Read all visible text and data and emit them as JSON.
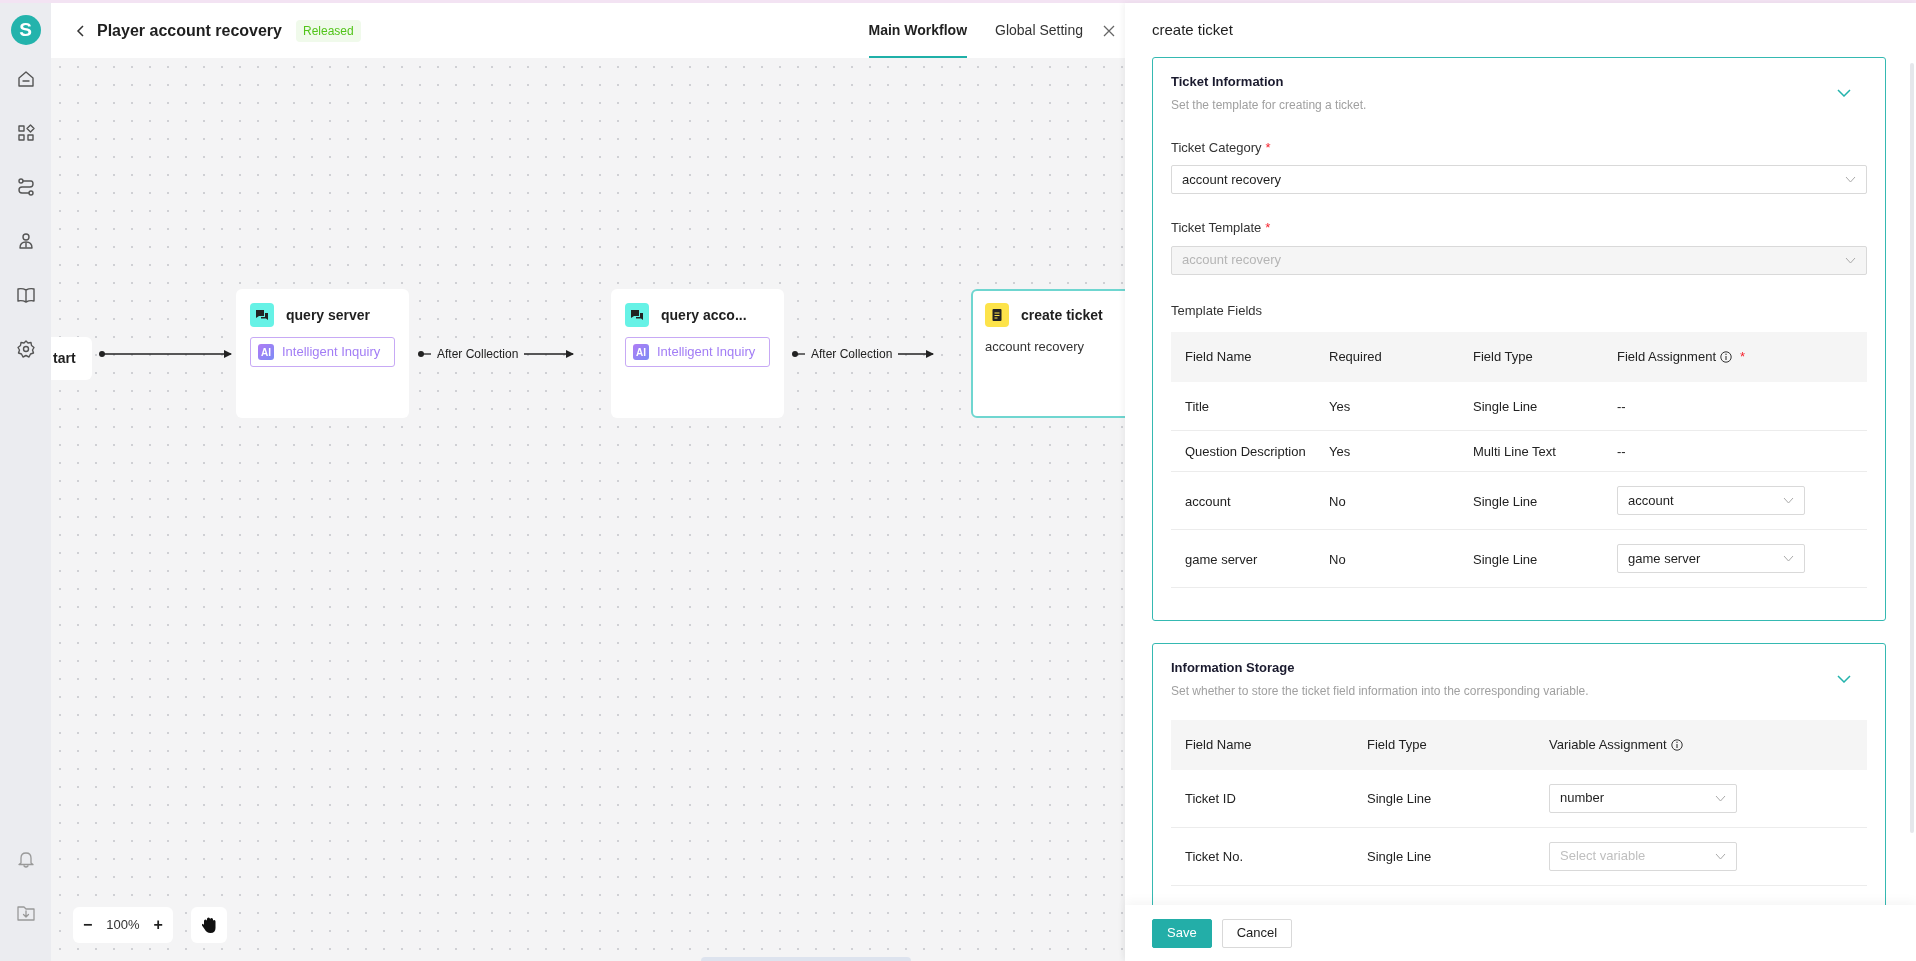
{
  "sidebar": {
    "logo": "S"
  },
  "header": {
    "title": "Player account recovery",
    "status_badge": "Released",
    "tabs": [
      {
        "label": "Main Workflow",
        "selected": true
      },
      {
        "label": "Global Setting",
        "selected": false
      }
    ]
  },
  "canvas": {
    "nodes": [
      {
        "kind": "start",
        "title": "tart",
        "selected": false
      },
      {
        "kind": "inquiry",
        "title": "query server",
        "tag": "Intelligent Inquiry",
        "tag_badge": "AI",
        "selected": false
      },
      {
        "kind": "inquiry",
        "title": "query acco...",
        "tag": "Intelligent Inquiry",
        "tag_badge": "AI",
        "selected": false
      },
      {
        "kind": "ticket",
        "title": "create ticket",
        "body": "account recovery",
        "selected": true
      }
    ],
    "edges": [
      {
        "kind": "plain"
      },
      {
        "kind": "labeled",
        "label": "After Collection"
      },
      {
        "kind": "labeled",
        "label": "After Collection"
      }
    ],
    "zoom": {
      "value": "100%",
      "minus": "−",
      "plus": "+"
    }
  },
  "panel": {
    "title": "create ticket",
    "sections": [
      {
        "title": "Ticket Information",
        "subtitle": "Set the template for creating a ticket.",
        "expanded": true,
        "fields": [
          {
            "label": "Ticket Category",
            "required_mark": "*",
            "value": "account recovery",
            "disabled": false
          },
          {
            "label": "Ticket Template",
            "required_mark": "*",
            "value": "account recovery",
            "disabled": true
          }
        ],
        "table_title": "Template Fields",
        "columns": [
          {
            "label": "Field Name",
            "info": false
          },
          {
            "label": "Required",
            "info": false
          },
          {
            "label": "Field Type",
            "info": false
          },
          {
            "label": "Field Assignment",
            "info": true,
            "required_mark": "*"
          }
        ],
        "rows": [
          {
            "cells": [
              "Title",
              "Yes",
              "Single Line"
            ],
            "assignment": {
              "kind": "text",
              "value": "--"
            }
          },
          {
            "cells": [
              "Question Description",
              "Yes",
              "Multi Line Text"
            ],
            "assignment": {
              "kind": "text",
              "value": "--"
            }
          },
          {
            "cells": [
              "account",
              "No",
              "Single Line"
            ],
            "assignment": {
              "kind": "select",
              "value": "account"
            }
          },
          {
            "cells": [
              "game server",
              "No",
              "Single Line"
            ],
            "assignment": {
              "kind": "select",
              "value": "game server"
            }
          }
        ]
      },
      {
        "title": "Information Storage",
        "subtitle": "Set whether to store the ticket field information into the corresponding variable.",
        "expanded": true,
        "columns": [
          {
            "label": "Field Name",
            "info": false
          },
          {
            "label": "Field Type",
            "info": false
          },
          {
            "label": "Variable Assignment",
            "info": true
          }
        ],
        "rows": [
          {
            "cells": [
              "Ticket ID",
              "Single Line"
            ],
            "assignment": {
              "kind": "select",
              "value": "number"
            }
          },
          {
            "cells": [
              "Ticket No.",
              "Single Line"
            ],
            "assignment": {
              "kind": "select",
              "placeholder": "Select variable"
            }
          }
        ]
      }
    ],
    "buttons": [
      {
        "label": "Save",
        "kind": "primary"
      },
      {
        "label": "Cancel",
        "kind": "secondary"
      }
    ]
  }
}
